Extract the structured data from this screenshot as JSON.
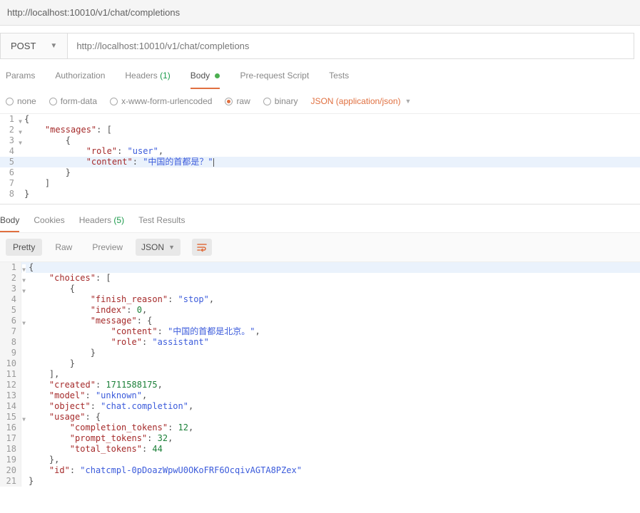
{
  "url_display": "http://localhost:10010/v1/chat/completions",
  "method": "POST",
  "url_input": "http://localhost:10010/v1/chat/completions",
  "req_tabs": {
    "params": "Params",
    "auth": "Authorization",
    "headers": "Headers",
    "headers_count": "(1)",
    "body": "Body",
    "prs": "Pre-request Script",
    "tests": "Tests"
  },
  "body_types": {
    "none": "none",
    "formdata": "form-data",
    "xform": "x-www-form-urlencoded",
    "raw": "raw",
    "binary": "binary",
    "content_type": "JSON (application/json)"
  },
  "req_body_lines": [
    {
      "n": "1",
      "fold": true,
      "ind": 0,
      "raw": "{"
    },
    {
      "n": "2",
      "fold": true,
      "ind": 1,
      "parts": [
        {
          "t": "key",
          "v": "\"messages\""
        },
        {
          "t": "p",
          "v": ": ["
        }
      ]
    },
    {
      "n": "3",
      "fold": true,
      "ind": 2,
      "raw": "{"
    },
    {
      "n": "4",
      "ind": 3,
      "parts": [
        {
          "t": "key",
          "v": "\"role\""
        },
        {
          "t": "p",
          "v": ": "
        },
        {
          "t": "str",
          "v": "\"user\""
        },
        {
          "t": "p",
          "v": ","
        }
      ]
    },
    {
      "n": "5",
      "hl": true,
      "ind": 3,
      "parts": [
        {
          "t": "key",
          "v": "\"content\""
        },
        {
          "t": "p",
          "v": ": "
        },
        {
          "t": "str",
          "v": "\"中国的首都是？\""
        }
      ],
      "cursor": true
    },
    {
      "n": "6",
      "ind": 2,
      "raw": "}"
    },
    {
      "n": "7",
      "ind": 1,
      "raw": "]"
    },
    {
      "n": "8",
      "ind": 0,
      "raw": "}"
    }
  ],
  "res_tabs": {
    "body": "Body",
    "cookies": "Cookies",
    "headers": "Headers",
    "headers_count": "(5)",
    "test_results": "Test Results"
  },
  "view_modes": {
    "pretty": "Pretty",
    "raw": "Raw",
    "preview": "Preview",
    "format": "JSON"
  },
  "res_body_lines": [
    {
      "n": "1",
      "fold": true,
      "hl": true,
      "ind": 0,
      "raw": "{"
    },
    {
      "n": "2",
      "fold": true,
      "ind": 1,
      "parts": [
        {
          "t": "key",
          "v": "\"choices\""
        },
        {
          "t": "p",
          "v": ": ["
        }
      ]
    },
    {
      "n": "3",
      "fold": true,
      "ind": 2,
      "raw": "{"
    },
    {
      "n": "4",
      "ind": 3,
      "parts": [
        {
          "t": "key",
          "v": "\"finish_reason\""
        },
        {
          "t": "p",
          "v": ": "
        },
        {
          "t": "str",
          "v": "\"stop\""
        },
        {
          "t": "p",
          "v": ","
        }
      ]
    },
    {
      "n": "5",
      "ind": 3,
      "parts": [
        {
          "t": "key",
          "v": "\"index\""
        },
        {
          "t": "p",
          "v": ": "
        },
        {
          "t": "num",
          "v": "0"
        },
        {
          "t": "p",
          "v": ","
        }
      ]
    },
    {
      "n": "6",
      "fold": true,
      "ind": 3,
      "parts": [
        {
          "t": "key",
          "v": "\"message\""
        },
        {
          "t": "p",
          "v": ": {"
        }
      ]
    },
    {
      "n": "7",
      "ind": 4,
      "parts": [
        {
          "t": "key",
          "v": "\"content\""
        },
        {
          "t": "p",
          "v": ": "
        },
        {
          "t": "str",
          "v": "\"中国的首都是北京。\""
        },
        {
          "t": "p",
          "v": ","
        }
      ]
    },
    {
      "n": "8",
      "ind": 4,
      "parts": [
        {
          "t": "key",
          "v": "\"role\""
        },
        {
          "t": "p",
          "v": ": "
        },
        {
          "t": "str",
          "v": "\"assistant\""
        }
      ]
    },
    {
      "n": "9",
      "ind": 3,
      "raw": "}"
    },
    {
      "n": "10",
      "ind": 2,
      "raw": "}"
    },
    {
      "n": "11",
      "ind": 1,
      "raw": "],"
    },
    {
      "n": "12",
      "ind": 1,
      "parts": [
        {
          "t": "key",
          "v": "\"created\""
        },
        {
          "t": "p",
          "v": ": "
        },
        {
          "t": "num",
          "v": "1711588175"
        },
        {
          "t": "p",
          "v": ","
        }
      ]
    },
    {
      "n": "13",
      "ind": 1,
      "parts": [
        {
          "t": "key",
          "v": "\"model\""
        },
        {
          "t": "p",
          "v": ": "
        },
        {
          "t": "str",
          "v": "\"unknown\""
        },
        {
          "t": "p",
          "v": ","
        }
      ]
    },
    {
      "n": "14",
      "ind": 1,
      "parts": [
        {
          "t": "key",
          "v": "\"object\""
        },
        {
          "t": "p",
          "v": ": "
        },
        {
          "t": "str",
          "v": "\"chat.completion\""
        },
        {
          "t": "p",
          "v": ","
        }
      ]
    },
    {
      "n": "15",
      "fold": true,
      "ind": 1,
      "parts": [
        {
          "t": "key",
          "v": "\"usage\""
        },
        {
          "t": "p",
          "v": ": {"
        }
      ]
    },
    {
      "n": "16",
      "ind": 2,
      "parts": [
        {
          "t": "key",
          "v": "\"completion_tokens\""
        },
        {
          "t": "p",
          "v": ": "
        },
        {
          "t": "num",
          "v": "12"
        },
        {
          "t": "p",
          "v": ","
        }
      ]
    },
    {
      "n": "17",
      "ind": 2,
      "parts": [
        {
          "t": "key",
          "v": "\"prompt_tokens\""
        },
        {
          "t": "p",
          "v": ": "
        },
        {
          "t": "num",
          "v": "32"
        },
        {
          "t": "p",
          "v": ","
        }
      ]
    },
    {
      "n": "18",
      "ind": 2,
      "parts": [
        {
          "t": "key",
          "v": "\"total_tokens\""
        },
        {
          "t": "p",
          "v": ": "
        },
        {
          "t": "num",
          "v": "44"
        }
      ]
    },
    {
      "n": "19",
      "ind": 1,
      "raw": "},"
    },
    {
      "n": "20",
      "ind": 1,
      "parts": [
        {
          "t": "key",
          "v": "\"id\""
        },
        {
          "t": "p",
          "v": ": "
        },
        {
          "t": "str",
          "v": "\"chatcmpl-0pDoazWpwU0OKoFRF6OcqivAGTA8PZex\""
        }
      ]
    },
    {
      "n": "21",
      "ind": 0,
      "raw": "}"
    }
  ]
}
